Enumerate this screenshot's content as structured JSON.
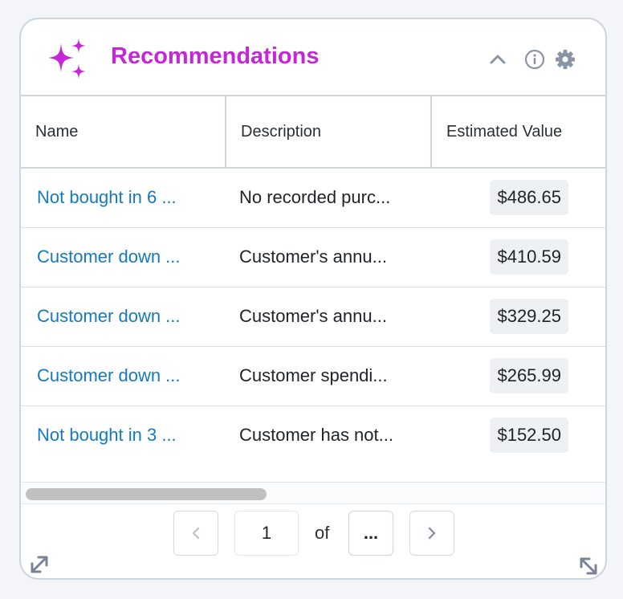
{
  "colors": {
    "accent": "#c327d6",
    "link": "#1579c0",
    "icon_gray": "#8a94a6"
  },
  "header": {
    "title": "Recommendations",
    "icons": [
      "sparkles-icon",
      "chevron-up-icon",
      "info-icon",
      "gear-icon"
    ]
  },
  "table": {
    "columns": [
      "Name",
      "Description",
      "Estimated Value"
    ],
    "rows": [
      {
        "name": "Not bought in 6 ...",
        "description": "No recorded purc...",
        "value": "$486.65"
      },
      {
        "name": "Customer down ...",
        "description": "Customer's annu...",
        "value": "$410.59"
      },
      {
        "name": "Customer down ...",
        "description": "Customer's annu...",
        "value": "$329.25"
      },
      {
        "name": "Customer down ...",
        "description": "Customer spendi...",
        "value": "$265.99"
      },
      {
        "name": "Not bought in 3 ...",
        "description": "Customer has not...",
        "value": "$152.50"
      }
    ]
  },
  "pagination": {
    "current_page": "1",
    "of_label": "of",
    "total_label": "..."
  }
}
